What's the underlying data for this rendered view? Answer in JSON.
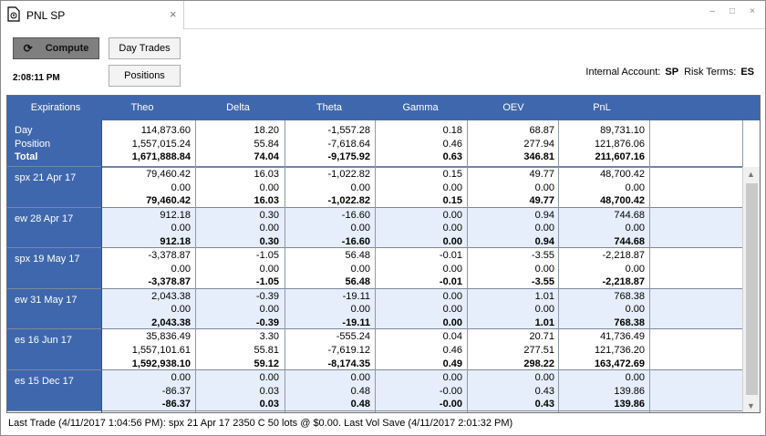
{
  "window": {
    "title": "PNL SP",
    "close": "×",
    "minimize": "–",
    "maximize": "□",
    "winclose": "×"
  },
  "toolbar": {
    "compute_label": "Compute",
    "daytrades_label": "Day Trades",
    "positions_label": "Positions",
    "time": "2:08:11 PM",
    "internal_account_label": "Internal Account:",
    "internal_account": "SP",
    "risk_terms_label": "Risk Terms:",
    "risk_terms": "ES"
  },
  "grid": {
    "columns": [
      "Expirations",
      "Theo",
      "Delta",
      "Theta",
      "Gamma",
      "OEV",
      "PnL"
    ],
    "summary": {
      "labels": [
        "Day",
        "Position",
        "Total"
      ],
      "rows": [
        [
          "114,873.60",
          "18.20",
          "-1,557.28",
          "0.18",
          "68.87",
          "89,731.10"
        ],
        [
          "1,557,015.24",
          "55.84",
          "-7,618.64",
          "0.46",
          "277.94",
          "121,876.06"
        ],
        [
          "1,671,888.84",
          "74.04",
          "-9,175.92",
          "0.63",
          "346.81",
          "211,607.16"
        ]
      ]
    },
    "groups": [
      {
        "name": "spx 21 Apr 17",
        "rows": [
          [
            "79,460.42",
            "16.03",
            "-1,022.82",
            "0.15",
            "49.77",
            "48,700.42"
          ],
          [
            "0.00",
            "0.00",
            "0.00",
            "0.00",
            "0.00",
            "0.00"
          ],
          [
            "79,460.42",
            "16.03",
            "-1,022.82",
            "0.15",
            "49.77",
            "48,700.42"
          ]
        ]
      },
      {
        "name": "ew 28 Apr 17",
        "rows": [
          [
            "912.18",
            "0.30",
            "-16.60",
            "0.00",
            "0.94",
            "744.68"
          ],
          [
            "0.00",
            "0.00",
            "0.00",
            "0.00",
            "0.00",
            "0.00"
          ],
          [
            "912.18",
            "0.30",
            "-16.60",
            "0.00",
            "0.94",
            "744.68"
          ]
        ]
      },
      {
        "name": "spx 19 May 17",
        "rows": [
          [
            "-3,378.87",
            "-1.05",
            "56.48",
            "-0.01",
            "-3.55",
            "-2,218.87"
          ],
          [
            "0.00",
            "0.00",
            "0.00",
            "0.00",
            "0.00",
            "0.00"
          ],
          [
            "-3,378.87",
            "-1.05",
            "56.48",
            "-0.01",
            "-3.55",
            "-2,218.87"
          ]
        ]
      },
      {
        "name": "ew 31 May 17",
        "rows": [
          [
            "2,043.38",
            "-0.39",
            "-19.11",
            "0.00",
            "1.01",
            "768.38"
          ],
          [
            "0.00",
            "0.00",
            "0.00",
            "0.00",
            "0.00",
            "0.00"
          ],
          [
            "2,043.38",
            "-0.39",
            "-19.11",
            "0.00",
            "1.01",
            "768.38"
          ]
        ]
      },
      {
        "name": "es 16 Jun 17",
        "rows": [
          [
            "35,836.49",
            "3.30",
            "-555.24",
            "0.04",
            "20.71",
            "41,736.49"
          ],
          [
            "1,557,101.61",
            "55.81",
            "-7,619.12",
            "0.46",
            "277.51",
            "121,736.20"
          ],
          [
            "1,592,938.10",
            "59.12",
            "-8,174.35",
            "0.49",
            "298.22",
            "163,472.69"
          ]
        ]
      },
      {
        "name": "es 15 Dec 17",
        "rows": [
          [
            "0.00",
            "0.00",
            "0.00",
            "0.00",
            "0.00",
            "0.00"
          ],
          [
            "-86.37",
            "0.03",
            "0.48",
            "-0.00",
            "0.43",
            "139.86"
          ],
          [
            "-86.37",
            "0.03",
            "0.48",
            "-0.00",
            "0.43",
            "139.86"
          ]
        ]
      }
    ]
  },
  "status": "Last Trade (4/11/2017 1:04:56 PM): spx 21 Apr 17 2350 C 50 lots @ $0.00.   Last Vol Save (4/11/2017 2:01:32 PM)",
  "colors": {
    "header": "#3f67ad",
    "alt_row": "#e6eefb"
  }
}
